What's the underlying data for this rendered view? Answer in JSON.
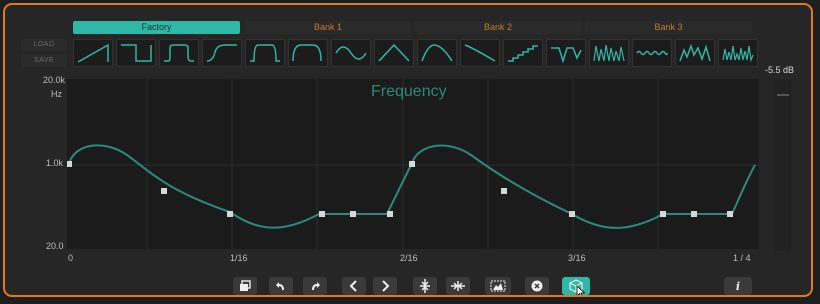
{
  "tabs": [
    {
      "label": "Factory",
      "active": true
    },
    {
      "label": "Bank 1",
      "active": false
    },
    {
      "label": "Bank 2",
      "active": false
    },
    {
      "label": "Bank 3",
      "active": false
    }
  ],
  "side_buttons": {
    "load": "LOAD",
    "save": "SAVE"
  },
  "shapes": [
    {
      "name": "ramp-up"
    },
    {
      "name": "square"
    },
    {
      "name": "rounded-square"
    },
    {
      "name": "exp-square"
    },
    {
      "name": "soft-square"
    },
    {
      "name": "smooth-square"
    },
    {
      "name": "sine"
    },
    {
      "name": "triangle"
    },
    {
      "name": "ramp-down-curve"
    },
    {
      "name": "saw-down"
    },
    {
      "name": "staircase"
    },
    {
      "name": "notch"
    },
    {
      "name": "sawtooth-burst"
    },
    {
      "name": "small-wave"
    },
    {
      "name": "random-peaks"
    },
    {
      "name": "noise"
    }
  ],
  "graph": {
    "title": "Frequency",
    "y_labels": {
      "top": "20.0k",
      "unit": "Hz",
      "mid": "1.0k",
      "bottom": "20.0"
    },
    "x_labels": [
      "0",
      "1/16",
      "2/16",
      "3/16",
      "1 / 4"
    ]
  },
  "meter": {
    "value_label": "-5.5 dB"
  },
  "toolbar": {
    "info_label": "i"
  },
  "colors": {
    "accent": "#2fb7a7",
    "frame": "#e07a1f",
    "curve": "#2b8a7e"
  }
}
